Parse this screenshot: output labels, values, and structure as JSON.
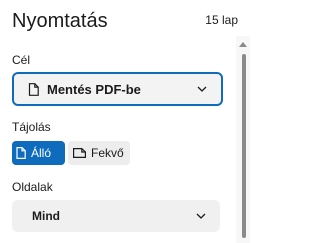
{
  "panel": {
    "title": "Nyomtatás",
    "page_count": "15 lap"
  },
  "destination": {
    "label": "Cél",
    "value": "Mentés PDF-be",
    "icon": "document-icon"
  },
  "orientation": {
    "label": "Tájolás",
    "options": [
      {
        "label": "Álló",
        "icon": "portrait-page-icon",
        "selected": true
      },
      {
        "label": "Fekvő",
        "icon": "landscape-page-icon",
        "selected": false
      }
    ]
  },
  "pages": {
    "label": "Oldalak",
    "value": "Mind"
  },
  "colors": {
    "accent": "#0f6cbd",
    "control_bg": "#f0f0f0",
    "text": "#1b1b1b"
  }
}
